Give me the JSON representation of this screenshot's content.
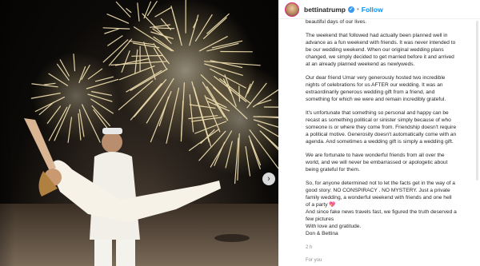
{
  "post": {
    "username": "bettinatrump",
    "separator": "•",
    "follow_label": "Follow",
    "next_icon": "chevron-right-icon"
  },
  "caption": {
    "top_line": "beautiful days of our lives.",
    "paragraphs": [
      [
        "The weekend that followed had actually been planned well in",
        "advance as a fun weekend with friends. It was never intended to",
        "be our wedding weekend. When our original wedding plans",
        "changed, we simply decided to get married before it and arrived",
        "at an already planned weekend as newlyweds."
      ],
      [
        "Our dear friend Umar very generously hosted two incredible",
        "nights of celebrations for us AFTER our wedding. It was an",
        "extraordinarily generous wedding gift from a friend, and",
        "something for which we were and remain incredibly grateful."
      ],
      [
        "It's unfortunate that something so personal and happy can be",
        "recast as something political or sinister simply because of who",
        "someone is or where they come from. Friendship doesn't require",
        "a political motive. Generosity doesn't automatically come with an",
        "agenda. And sometimes a wedding gift is simply a wedding gift."
      ],
      [
        "We are fortunate to have wonderful friends from all over the",
        "world, and we will never be embarrassed or apologetic about",
        "being grateful for them."
      ],
      [
        "So, for anyone determined not to let the facts get in the way of a",
        "good story: NO CONSPIRACY . NO MYSTERY. Just a private",
        "family wedding, a wonderful weekend with friends and one hell",
        "of a party 💖",
        "And since fake news travels fast, we figured the truth deserved a",
        "few pictures",
        "With love and gratitude.",
        "Don & Bettina"
      ]
    ],
    "timestamp": "2 h",
    "footer_peek": "For you"
  }
}
